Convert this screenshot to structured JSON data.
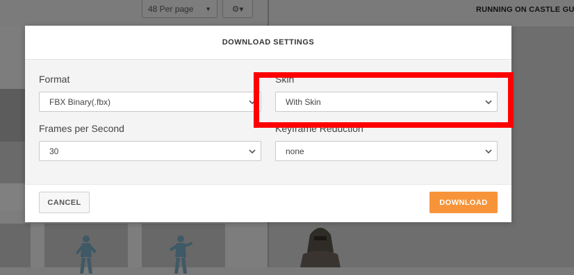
{
  "background": {
    "per_page_label": "48 Per page",
    "gear_label": "⚙▾",
    "animation_title": "RUNNING ON CASTLE GU"
  },
  "modal": {
    "title": "DOWNLOAD SETTINGS",
    "format": {
      "label": "Format",
      "value": "FBX Binary(.fbx)"
    },
    "skin": {
      "label": "Skin",
      "value": "With Skin"
    },
    "fps": {
      "label": "Frames per Second",
      "value": "30"
    },
    "keyframe": {
      "label": "Keyframe Reduction",
      "value": "none"
    },
    "cancel_label": "CANCEL",
    "download_label": "DOWNLOAD"
  },
  "colors": {
    "accent": "#f7943a",
    "highlight": "#ff0000"
  },
  "icons": [
    "chevron-down-icon",
    "gear-icon"
  ]
}
